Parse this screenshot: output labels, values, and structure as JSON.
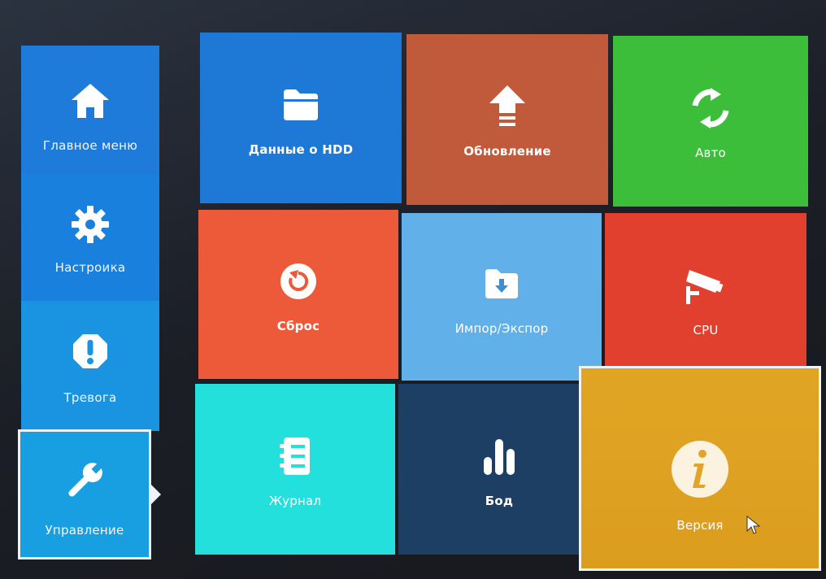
{
  "sidebar": {
    "items": [
      {
        "label": "Главное меню",
        "icon": "home-icon"
      },
      {
        "label": "Настроика",
        "icon": "gear-icon"
      },
      {
        "label": "Тревога",
        "icon": "alert-icon"
      },
      {
        "label": "Управление",
        "icon": "wrench-icon",
        "selected": true
      }
    ]
  },
  "tiles": [
    {
      "label": "Данные о HDD",
      "icon": "folder-icon",
      "color": "#1e78d6"
    },
    {
      "label": "Обновление",
      "icon": "upload-arrow-icon",
      "color": "#c15a3b"
    },
    {
      "label": "Авто",
      "icon": "refresh-icon",
      "color": "#3cbe3b"
    },
    {
      "label": "Сброс",
      "icon": "reset-icon",
      "color": "#ec5a3a"
    },
    {
      "label": "Импор/Экспор",
      "icon": "folder-download-icon",
      "color": "#62b0e9"
    },
    {
      "label": "CPU",
      "icon": "camera-icon",
      "color": "#e2402e"
    },
    {
      "label": "Журнал",
      "icon": "log-icon",
      "color": "#24e0dc"
    },
    {
      "label": "Бод",
      "icon": "bar-chart-icon",
      "color": "#1d3f63"
    },
    {
      "label": "Версия",
      "icon": "info-icon",
      "color": "#dc9d1e",
      "highlighted": true
    }
  ]
}
